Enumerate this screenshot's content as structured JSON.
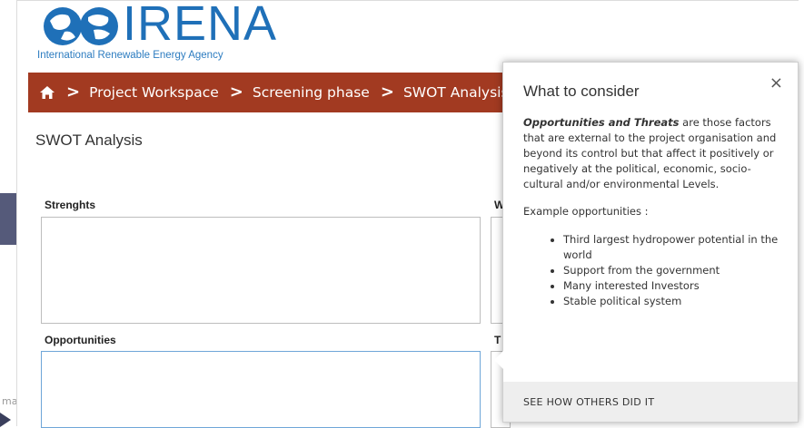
{
  "logo": {
    "name": "IRENA",
    "tagline": "International Renewable Energy Agency"
  },
  "nav": {
    "breadcrumbs": [
      "Project Workspace",
      "Screening phase",
      "SWOT Analysis"
    ]
  },
  "page": {
    "title": "SWOT Analysis"
  },
  "sections": {
    "strengths_label": "Strenghts",
    "weaknesses_label": "W",
    "opportunities_label": "Opportunities",
    "threats_label": "T"
  },
  "background": {
    "partial_text": "ma"
  },
  "popover": {
    "title": "What to consider",
    "close": "×",
    "lead": "Opportunities and Threats",
    "description": " are those factors that are external to the project organisation and beyond its control but that affect it positively or negatively at the political, economic, socio-cultural and/or environmental Levels.",
    "example_heading": "Example opportunities :",
    "examples": [
      "Third largest hydropower potential in the world",
      "Support from the government",
      "Many interested Investors",
      "Stable political system"
    ],
    "footer_link": "SEE HOW OTHERS DID IT"
  },
  "colors": {
    "nav_bar": "#a23a21",
    "brand_blue": "#1f70b8",
    "focus_border": "#6fa6d8"
  }
}
